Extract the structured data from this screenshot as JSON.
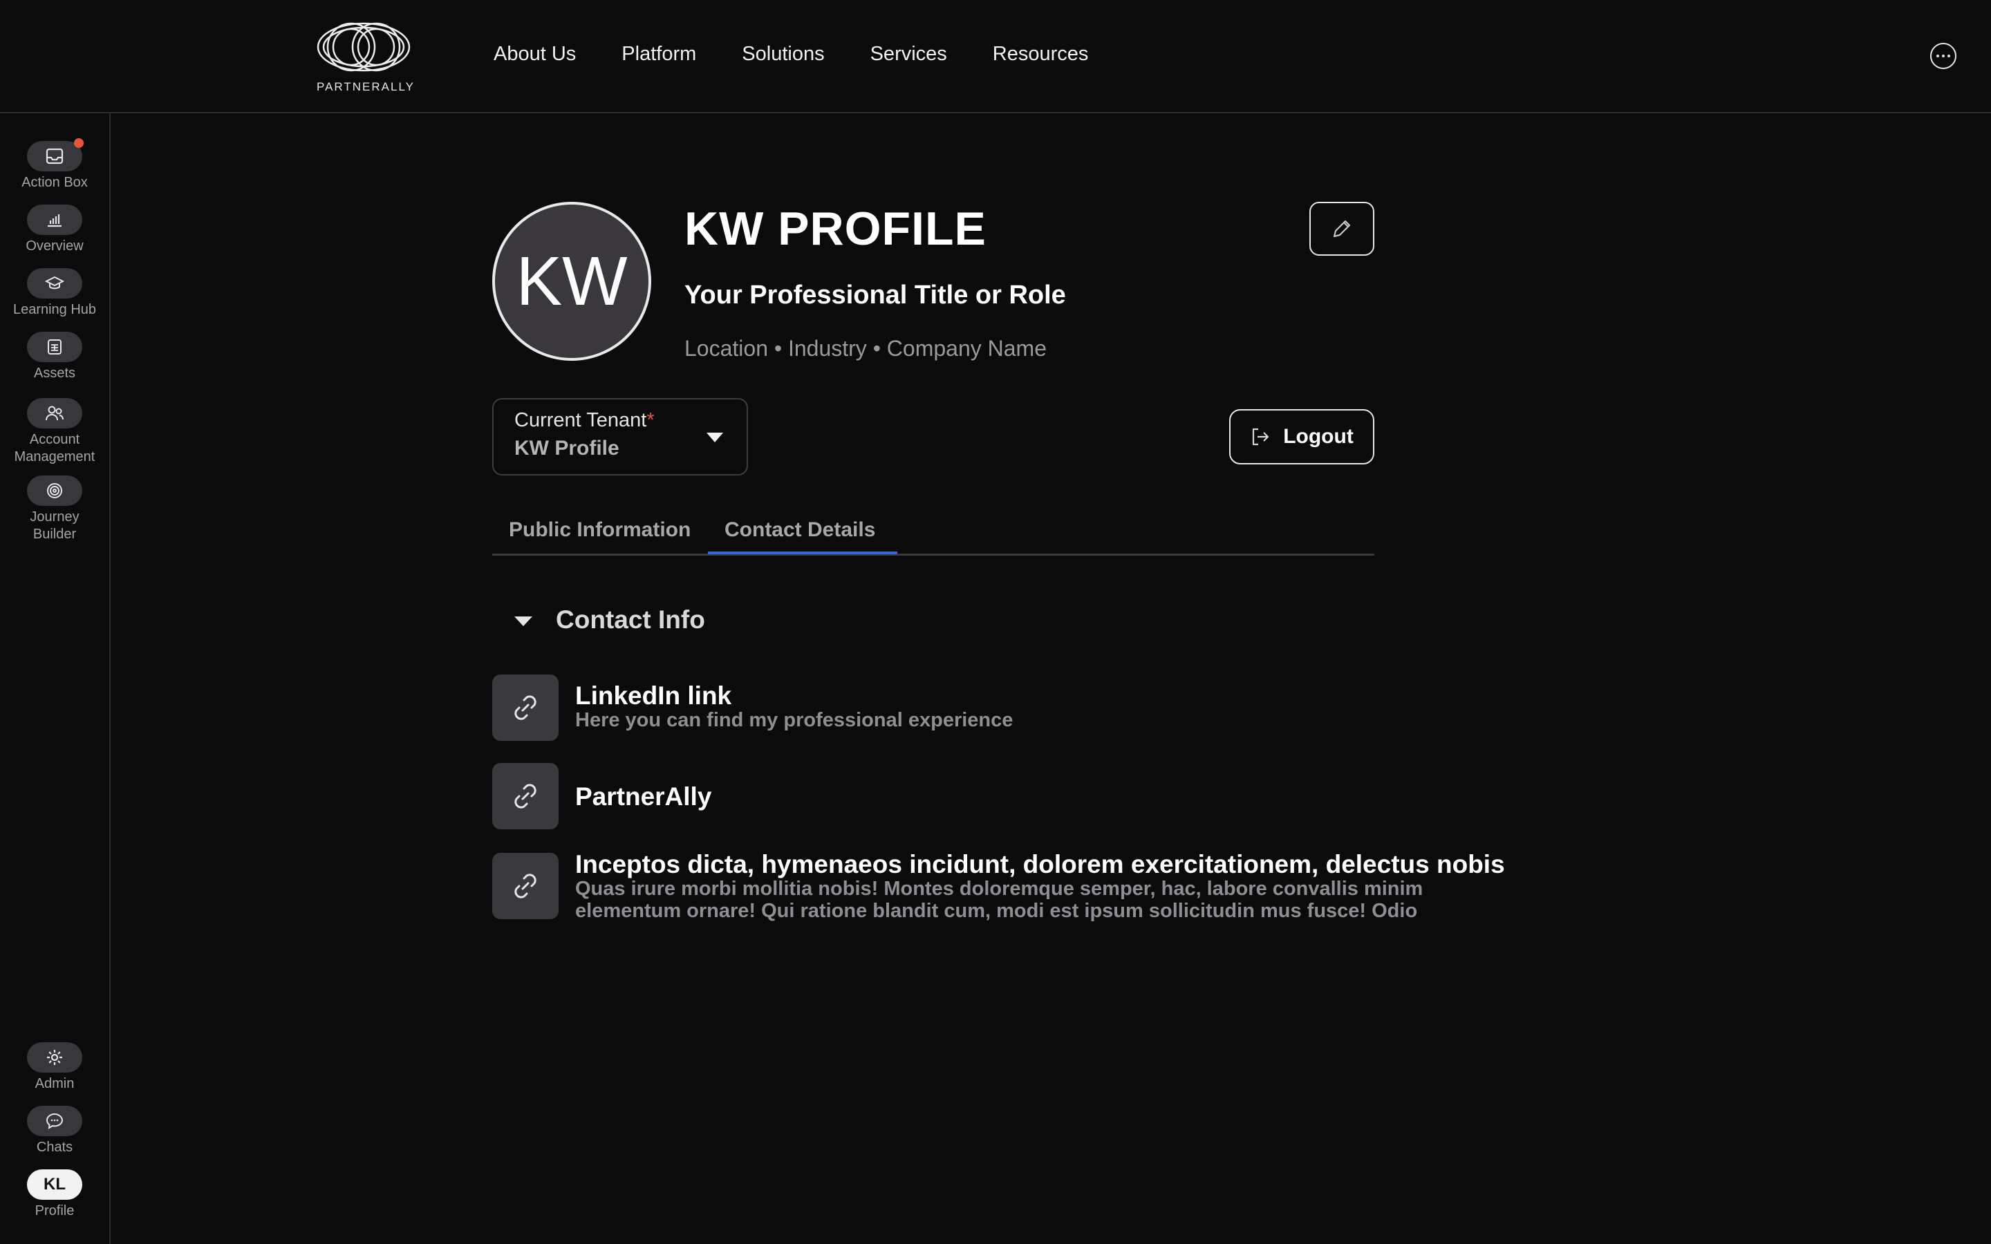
{
  "brand": {
    "logo_text": "PARTNERALLY"
  },
  "nav": {
    "items": [
      "About Us",
      "Platform",
      "Solutions",
      "Services",
      "Resources"
    ],
    "more_icon": "more-horizontal-icon"
  },
  "sidebar": {
    "items": [
      {
        "label": "Action Box",
        "icon": "inbox-icon",
        "badge": true
      },
      {
        "label": "Overview",
        "icon": "bar-chart-icon"
      },
      {
        "label": "Learning Hub",
        "icon": "graduation-cap-icon"
      },
      {
        "label": "Assets",
        "icon": "grid-icon"
      },
      {
        "label": "Account\nManagement",
        "icon": "users-icon"
      },
      {
        "label": "Journey\nBuilder",
        "icon": "target-icon"
      }
    ],
    "bottom": [
      {
        "label": "Admin",
        "icon": "gear-icon"
      },
      {
        "label": "Chats",
        "icon": "chat-icon"
      },
      {
        "label": "Profile",
        "initials": "KL"
      }
    ]
  },
  "profile": {
    "initials": "KW",
    "name": "KW PROFILE",
    "title": "Your Professional Title or Role",
    "meta": "Location • Industry • Company Name"
  },
  "tenant": {
    "label": "Current Tenant",
    "required_mark": "*",
    "value": "KW Profile"
  },
  "actions": {
    "logout_label": "Logout"
  },
  "tabs": [
    {
      "label": "Public Information",
      "active": false
    },
    {
      "label": "Contact Details",
      "active": true
    }
  ],
  "contact_section": {
    "title": "Contact Info",
    "links": [
      {
        "title": "LinkedIn link",
        "description": "Here you can find my professional experience"
      },
      {
        "title": "PartnerAlly",
        "description": ""
      },
      {
        "title": "Inceptos dicta, hymenaeos incidunt, dolorem exercitationem, delectus nobis",
        "description": "Quas irure morbi mollitia nobis! Montes doloremque semper, hac, labore convallis minim elementum ornare! Qui ratione blandit cum, modi est ipsum sollicitudin mus fusce! Odio"
      }
    ]
  },
  "colors": {
    "background": "#0b0b0c",
    "accent": "#2d6ad2",
    "badge": "#e4573d"
  }
}
